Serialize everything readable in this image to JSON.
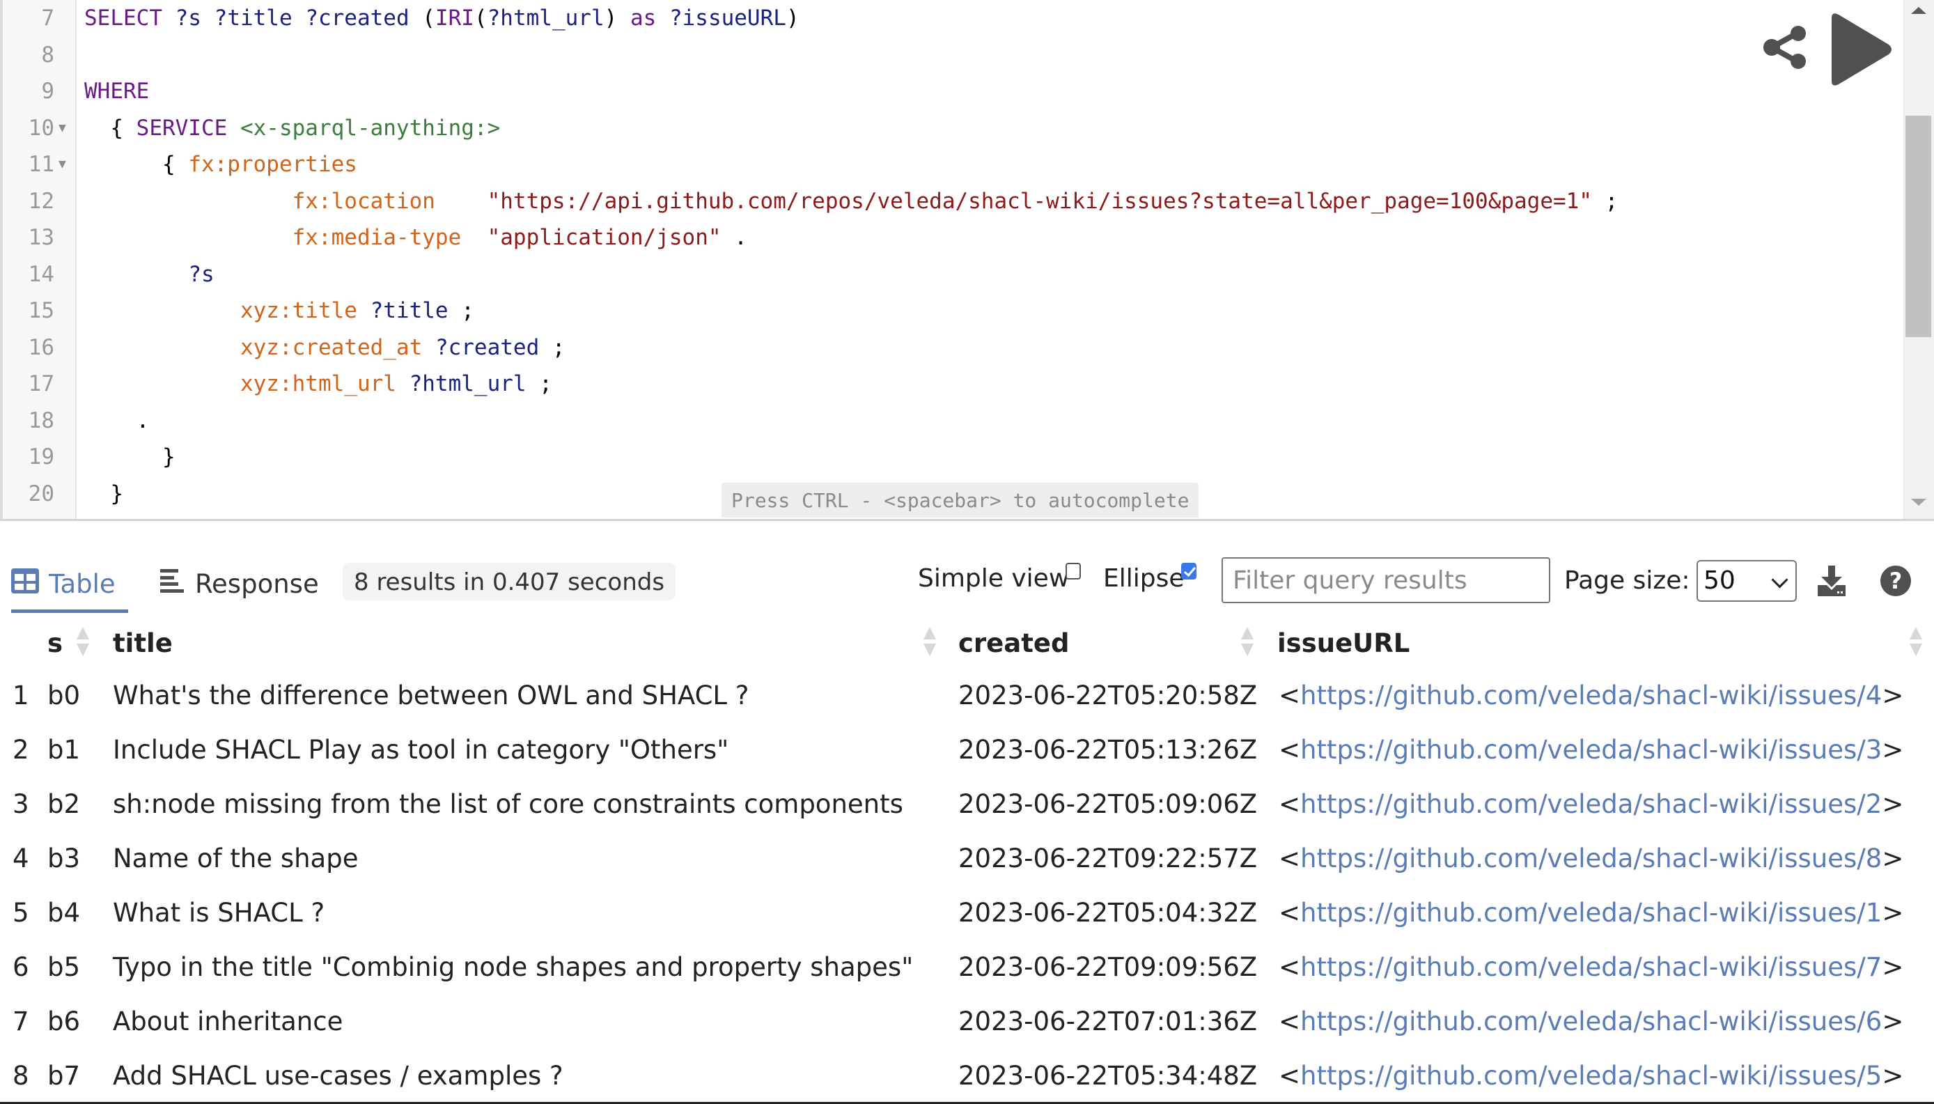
{
  "editor": {
    "lines": [
      {
        "num": "7",
        "fold": false,
        "tokens": [
          {
            "t": "SELECT ",
            "c": "kw"
          },
          {
            "t": "?s ",
            "c": "var"
          },
          {
            "t": "?title ",
            "c": "var"
          },
          {
            "t": "?created ",
            "c": "var"
          },
          {
            "t": "(",
            "c": "punc"
          },
          {
            "t": "IRI",
            "c": "kw"
          },
          {
            "t": "(",
            "c": "punc"
          },
          {
            "t": "?html_url",
            "c": "var"
          },
          {
            "t": ") ",
            "c": "punc"
          },
          {
            "t": "as ",
            "c": "kw"
          },
          {
            "t": "?issueURL",
            "c": "var"
          },
          {
            "t": ")",
            "c": "punc"
          }
        ]
      },
      {
        "num": "8",
        "fold": false,
        "tokens": []
      },
      {
        "num": "9",
        "fold": false,
        "tokens": [
          {
            "t": "WHERE",
            "c": "kw"
          }
        ]
      },
      {
        "num": "10",
        "fold": true,
        "tokens": [
          {
            "t": "  { ",
            "c": "punc"
          },
          {
            "t": "SERVICE ",
            "c": "kw"
          },
          {
            "t": "<x-sparql-anything:>",
            "c": "iri"
          }
        ]
      },
      {
        "num": "11",
        "fold": true,
        "tokens": [
          {
            "t": "      { ",
            "c": "punc"
          },
          {
            "t": "fx:properties",
            "c": "pred"
          }
        ]
      },
      {
        "num": "12",
        "fold": false,
        "tokens": [
          {
            "t": "                ",
            "c": "punc"
          },
          {
            "t": "fx:location",
            "c": "pred"
          },
          {
            "t": "    ",
            "c": "punc"
          },
          {
            "t": "\"https://api.github.com/repos/veleda/shacl-wiki/issues?state=all&per_page=100&page=1\"",
            "c": "str"
          },
          {
            "t": " ;",
            "c": "punc"
          }
        ]
      },
      {
        "num": "13",
        "fold": false,
        "tokens": [
          {
            "t": "                ",
            "c": "punc"
          },
          {
            "t": "fx:media-type",
            "c": "pred"
          },
          {
            "t": "  ",
            "c": "punc"
          },
          {
            "t": "\"application/json\"",
            "c": "str"
          },
          {
            "t": " .",
            "c": "punc"
          }
        ]
      },
      {
        "num": "14",
        "fold": false,
        "tokens": [
          {
            "t": "        ",
            "c": "punc"
          },
          {
            "t": "?s",
            "c": "var"
          }
        ]
      },
      {
        "num": "15",
        "fold": false,
        "tokens": [
          {
            "t": "            ",
            "c": "punc"
          },
          {
            "t": "xyz:title ",
            "c": "pred"
          },
          {
            "t": "?title",
            "c": "var"
          },
          {
            "t": " ;",
            "c": "punc"
          }
        ]
      },
      {
        "num": "16",
        "fold": false,
        "tokens": [
          {
            "t": "            ",
            "c": "punc"
          },
          {
            "t": "xyz:created_at ",
            "c": "pred"
          },
          {
            "t": "?created",
            "c": "var"
          },
          {
            "t": " ;",
            "c": "punc"
          }
        ]
      },
      {
        "num": "17",
        "fold": false,
        "tokens": [
          {
            "t": "            ",
            "c": "punc"
          },
          {
            "t": "xyz:html_url ",
            "c": "pred"
          },
          {
            "t": "?html_url",
            "c": "var"
          },
          {
            "t": " ;",
            "c": "punc"
          }
        ]
      },
      {
        "num": "18",
        "fold": false,
        "tokens": [
          {
            "t": "    .",
            "c": "punc"
          }
        ]
      },
      {
        "num": "19",
        "fold": false,
        "tokens": [
          {
            "t": "      }",
            "c": "punc"
          }
        ]
      },
      {
        "num": "20",
        "fold": false,
        "tokens": [
          {
            "t": "  }",
            "c": "punc"
          }
        ]
      }
    ],
    "autocomplete_hint": "Press CTRL - <spacebar> to autocomplete",
    "share_icon": "share-icon",
    "run_icon": "play-icon"
  },
  "results": {
    "tabs": [
      {
        "label": "Table",
        "icon": "table-icon",
        "active": true
      },
      {
        "label": "Response",
        "icon": "lines-icon",
        "active": false
      }
    ],
    "summary": "8 results in 0.407 seconds",
    "simple_view_label": "Simple view",
    "simple_view_checked": false,
    "ellipse_label": "Ellipse",
    "ellipse_checked": true,
    "filter_placeholder": "Filter query results",
    "filter_value": "",
    "page_size_label": "Page size:",
    "page_size_value": "50",
    "download_icon": "download-icon",
    "help_icon": "help-icon",
    "accent_color": "#5b7bb4"
  },
  "table": {
    "columns": [
      "s",
      "title",
      "created",
      "issueURL"
    ],
    "rows": [
      {
        "idx": "1",
        "s": "b0",
        "title": "What's the difference between OWL and SHACL ?",
        "created": "2023-06-22T05:20:58Z",
        "url": "https://github.com/veleda/shacl-wiki/issues/4"
      },
      {
        "idx": "2",
        "s": "b1",
        "title": "Include SHACL Play as tool in category \"Others\"",
        "created": "2023-06-22T05:13:26Z",
        "url": "https://github.com/veleda/shacl-wiki/issues/3"
      },
      {
        "idx": "3",
        "s": "b2",
        "title": "sh:node missing from the list of core constraints components",
        "created": "2023-06-22T05:09:06Z",
        "url": "https://github.com/veleda/shacl-wiki/issues/2"
      },
      {
        "idx": "4",
        "s": "b3",
        "title": "Name of the shape",
        "created": "2023-06-22T09:22:57Z",
        "url": "https://github.com/veleda/shacl-wiki/issues/8"
      },
      {
        "idx": "5",
        "s": "b4",
        "title": "What is SHACL ?",
        "created": "2023-06-22T05:04:32Z",
        "url": "https://github.com/veleda/shacl-wiki/issues/1"
      },
      {
        "idx": "6",
        "s": "b5",
        "title": "Typo in the title \"Combinig node shapes and property shapes\"",
        "created": "2023-06-22T09:09:56Z",
        "url": "https://github.com/veleda/shacl-wiki/issues/7"
      },
      {
        "idx": "7",
        "s": "b6",
        "title": "About inheritance",
        "created": "2023-06-22T07:01:36Z",
        "url": "https://github.com/veleda/shacl-wiki/issues/6"
      },
      {
        "idx": "8",
        "s": "b7",
        "title": "Add SHACL use-cases / examples ?",
        "created": "2023-06-22T05:34:48Z",
        "url": "https://github.com/veleda/shacl-wiki/issues/5"
      }
    ]
  }
}
